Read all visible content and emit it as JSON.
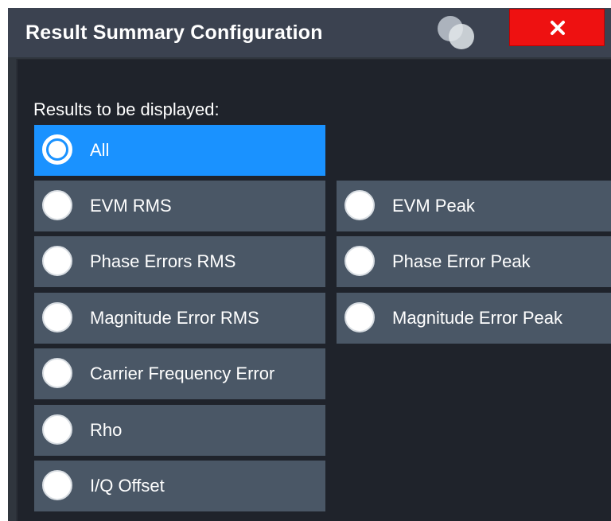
{
  "dialog": {
    "title": "Result Summary Configuration",
    "close_label": "X",
    "colors": {
      "title_bar": "#3b4250",
      "background": "#1f232b",
      "option": "#4a5766",
      "selected_option": "#1a92ff",
      "close": "#ee1111"
    }
  },
  "results": {
    "label": "Results to be displayed:",
    "selected": "All",
    "options": [
      {
        "label": "All",
        "checked": true
      },
      {
        "label": "EVM RMS",
        "checked": false
      },
      {
        "label": "EVM Peak",
        "checked": false
      },
      {
        "label": "Phase Errors RMS",
        "checked": false
      },
      {
        "label": "Phase Error Peak",
        "checked": false
      },
      {
        "label": "Magnitude Error RMS",
        "checked": false
      },
      {
        "label": "Magnitude Error Peak",
        "checked": false
      },
      {
        "label": "Carrier Frequency Error",
        "checked": false
      },
      {
        "label": "Rho",
        "checked": false
      },
      {
        "label": "I/Q Offset",
        "checked": false
      }
    ]
  }
}
